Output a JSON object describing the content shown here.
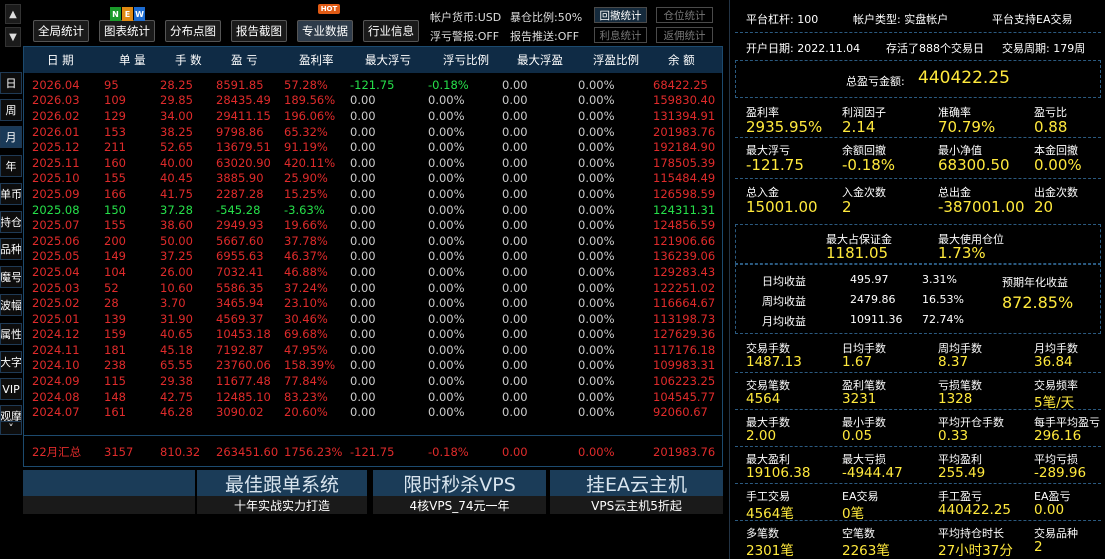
{
  "nav": {
    "up": "▲",
    "down": "▼"
  },
  "side_tabs": [
    "日",
    "周",
    "月",
    "年",
    "单币",
    "持仓",
    "品种",
    "魔号",
    "波幅",
    "属性",
    "大字",
    "VIP",
    "观摩",
    "˅"
  ],
  "toolbar": {
    "btn1": "全局统计",
    "btn2": "图表统计",
    "btn3": "分布点图",
    "btn4": "报告截图",
    "btn5": "专业数据",
    "btn6": "行业信息",
    "new_badge": [
      "N",
      "E",
      "W"
    ],
    "hot_badge": "HOT"
  },
  "status": {
    "currency": "帐户货币:USD",
    "exposure": "暴仓比例:50%",
    "float_alarm": "浮亏警报:OFF",
    "report_push": "报告推送:OFF",
    "btn_drawdown": "回撤统计",
    "btn_position": "仓位统计",
    "btn_profit": "利息统计",
    "btn_return": "返佣统计"
  },
  "table": {
    "headers": [
      "日 期",
      "单 量",
      "手 数",
      "盈 亏",
      "盈利率",
      "最大浮亏",
      "浮亏比例",
      "最大浮盈",
      "浮盈比例",
      "余 额"
    ],
    "rows": [
      [
        "2026.04",
        "95",
        "28.25",
        "8591.85",
        "57.28%",
        "-121.75",
        "-0.18%",
        "0.00",
        "0.00%",
        "68422.25",
        "red",
        "green"
      ],
      [
        "2026.03",
        "109",
        "29.85",
        "28435.49",
        "189.56%",
        "0.00",
        "0.00%",
        "0.00",
        "0.00%",
        "159830.40",
        "red",
        "gray"
      ],
      [
        "2026.02",
        "129",
        "34.00",
        "29411.15",
        "196.06%",
        "0.00",
        "0.00%",
        "0.00",
        "0.00%",
        "131394.91",
        "red",
        "gray"
      ],
      [
        "2026.01",
        "153",
        "38.25",
        "9798.86",
        "65.32%",
        "0.00",
        "0.00%",
        "0.00",
        "0.00%",
        "201983.76",
        "red",
        "gray"
      ],
      [
        "2025.12",
        "211",
        "52.65",
        "13679.51",
        "91.19%",
        "0.00",
        "0.00%",
        "0.00",
        "0.00%",
        "192184.90",
        "red",
        "gray"
      ],
      [
        "2025.11",
        "160",
        "40.00",
        "63020.90",
        "420.11%",
        "0.00",
        "0.00%",
        "0.00",
        "0.00%",
        "178505.39",
        "red",
        "gray"
      ],
      [
        "2025.10",
        "155",
        "40.45",
        "3885.90",
        "25.90%",
        "0.00",
        "0.00%",
        "0.00",
        "0.00%",
        "115484.49",
        "red",
        "gray"
      ],
      [
        "2025.09",
        "166",
        "41.75",
        "2287.28",
        "15.25%",
        "0.00",
        "0.00%",
        "0.00",
        "0.00%",
        "126598.59",
        "red",
        "gray"
      ],
      [
        "2025.08",
        "150",
        "37.28",
        "-545.28",
        "-3.63%",
        "0.00",
        "0.00%",
        "0.00",
        "0.00%",
        "124311.31",
        "green",
        "gray"
      ],
      [
        "2025.07",
        "155",
        "38.60",
        "2949.93",
        "19.66%",
        "0.00",
        "0.00%",
        "0.00",
        "0.00%",
        "124856.59",
        "red",
        "gray"
      ],
      [
        "2025.06",
        "200",
        "50.00",
        "5667.60",
        "37.78%",
        "0.00",
        "0.00%",
        "0.00",
        "0.00%",
        "121906.66",
        "red",
        "gray"
      ],
      [
        "2025.05",
        "149",
        "37.25",
        "6955.63",
        "46.37%",
        "0.00",
        "0.00%",
        "0.00",
        "0.00%",
        "136239.06",
        "red",
        "gray"
      ],
      [
        "2025.04",
        "104",
        "26.00",
        "7032.41",
        "46.88%",
        "0.00",
        "0.00%",
        "0.00",
        "0.00%",
        "129283.43",
        "red",
        "gray"
      ],
      [
        "2025.03",
        "52",
        "10.60",
        "5586.35",
        "37.24%",
        "0.00",
        "0.00%",
        "0.00",
        "0.00%",
        "122251.02",
        "red",
        "gray"
      ],
      [
        "2025.02",
        "28",
        "3.70",
        "3465.94",
        "23.10%",
        "0.00",
        "0.00%",
        "0.00",
        "0.00%",
        "116664.67",
        "red",
        "gray"
      ],
      [
        "2025.01",
        "139",
        "31.90",
        "4569.37",
        "30.46%",
        "0.00",
        "0.00%",
        "0.00",
        "0.00%",
        "113198.73",
        "red",
        "gray"
      ],
      [
        "2024.12",
        "159",
        "40.65",
        "10453.18",
        "69.68%",
        "0.00",
        "0.00%",
        "0.00",
        "0.00%",
        "127629.36",
        "red",
        "gray"
      ],
      [
        "2024.11",
        "181",
        "45.18",
        "7192.87",
        "47.95%",
        "0.00",
        "0.00%",
        "0.00",
        "0.00%",
        "117176.18",
        "red",
        "gray"
      ],
      [
        "2024.10",
        "238",
        "65.55",
        "23760.06",
        "158.39%",
        "0.00",
        "0.00%",
        "0.00",
        "0.00%",
        "109983.31",
        "red",
        "gray"
      ],
      [
        "2024.09",
        "115",
        "29.38",
        "11677.48",
        "77.84%",
        "0.00",
        "0.00%",
        "0.00",
        "0.00%",
        "106223.25",
        "red",
        "gray"
      ],
      [
        "2024.08",
        "148",
        "42.75",
        "12485.10",
        "83.23%",
        "0.00",
        "0.00%",
        "0.00",
        "0.00%",
        "104545.77",
        "red",
        "gray"
      ],
      [
        "2024.07",
        "161",
        "46.28",
        "3090.02",
        "20.60%",
        "0.00",
        "0.00%",
        "0.00",
        "0.00%",
        "92060.67",
        "red",
        "gray"
      ]
    ],
    "summary": [
      "22月汇总",
      "3157",
      "810.32",
      "263451.60",
      "1756.23%",
      "-121.75",
      "-0.18%",
      "0.00",
      "0.00%",
      "201983.76"
    ]
  },
  "banners": [
    {
      "title": "最佳跟单系统",
      "sub": "十年实战实力打造"
    },
    {
      "title": "限时秒杀VPS",
      "sub": "4核VPS_74元一年"
    },
    {
      "title": "挂EA云主机",
      "sub": "VPS云主机5折起"
    }
  ],
  "panel": {
    "leverage": "平台杠杆:  100",
    "account_type": "帐户类型:  实盘帐户",
    "ea_support": "平台支持EA交易",
    "open_date": "开户日期:  2022.11.04",
    "survived": "存活了888个交易日",
    "cycle": "交易周期:  179周",
    "total_label": "总盈亏金额:",
    "total_value": "440422.25",
    "g1": [
      [
        "盈利率",
        "2935.95%"
      ],
      [
        "利润因子",
        "2.14"
      ],
      [
        "准确率",
        "70.79%"
      ],
      [
        "盈亏比",
        "0.88"
      ],
      [
        "最大浮亏",
        "-121.75"
      ],
      [
        "余额回撤",
        "-0.18%"
      ],
      [
        "最小净值",
        "68300.50"
      ],
      [
        "本金回撤",
        "0.00%"
      ],
      [
        "总入金",
        "15001.00"
      ],
      [
        "入金次数",
        "2"
      ],
      [
        "总出金",
        "-387001.00"
      ],
      [
        "出金次数",
        "20"
      ]
    ],
    "margin_label": "最大占保证金",
    "margin_value": "1181.05",
    "usage_label": "最大使用仓位",
    "usage_value": "1.73%",
    "income": [
      [
        "日均收益",
        "495.97",
        "3.31%"
      ],
      [
        "周均收益",
        "2479.86",
        "16.53%"
      ],
      [
        "月均收益",
        "10911.36",
        "72.74%"
      ]
    ],
    "annual_label": "预期年化收益",
    "annual_value": "872.85%",
    "g2": [
      [
        "交易手数",
        "1487.13"
      ],
      [
        "日均手数",
        "1.67"
      ],
      [
        "周均手数",
        "8.37"
      ],
      [
        "月均手数",
        "36.84"
      ],
      [
        "交易笔数",
        "4564"
      ],
      [
        "盈利笔数",
        "3231"
      ],
      [
        "亏损笔数",
        "1328"
      ],
      [
        "交易频率",
        "5笔/天"
      ],
      [
        "最大手数",
        "2.00"
      ],
      [
        "最小手数",
        "0.05"
      ],
      [
        "平均开仓手数",
        "0.33"
      ],
      [
        "每手平均盈亏",
        "296.16"
      ],
      [
        "最大盈利",
        "19106.38"
      ],
      [
        "最大亏损",
        "-4944.47"
      ],
      [
        "平均盈利",
        "255.49"
      ],
      [
        "平均亏损",
        "-289.96"
      ],
      [
        "手工交易",
        "4564笔"
      ],
      [
        "EA交易",
        "0笔"
      ],
      [
        "手工盈亏",
        "440422.25"
      ],
      [
        "EA盈亏",
        "0.00"
      ],
      [
        "多笔数",
        "2301笔"
      ],
      [
        "空笔数",
        "2263笔"
      ],
      [
        "平均持仓时长",
        "27小时37分"
      ],
      [
        "交易品种",
        "2"
      ]
    ]
  }
}
